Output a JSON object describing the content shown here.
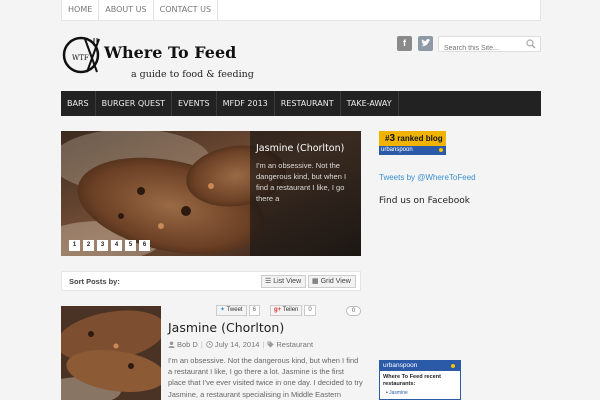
{
  "topnav": {
    "items": [
      "Home",
      "About Us",
      "Contact Us"
    ]
  },
  "logo": {
    "mark_text": "WTF",
    "name": "Where To Feed",
    "tagline": "a guide to food & feeding"
  },
  "header": {
    "search_placeholder": "Search this Site...",
    "social_icons": [
      "facebook-icon",
      "twitter-icon"
    ]
  },
  "mainnav": {
    "items": [
      "Bars",
      "Burger Quest",
      "Events",
      "MFDF 2013",
      "Restaurant",
      "Take-Away"
    ]
  },
  "slider": {
    "title": "Jasmine (Chorlton)",
    "text": "I'm an obsessive. Not the dangerous kind, but when I find a restaurant I like, I go there a",
    "pages": [
      "1",
      "2",
      "3",
      "4",
      "5",
      "6"
    ]
  },
  "sortbar": {
    "label": "Sort Posts by:",
    "list_view": "List View",
    "grid_view": "Grid View"
  },
  "post": {
    "share": {
      "tweet": "Tweet",
      "tweet_count": "6",
      "gplus": "Teilen",
      "gplus_count": "0"
    },
    "comments": "0",
    "title": "Jasmine (Chorlton)",
    "author": "Bob D",
    "date": "July 14, 2014",
    "category": "Restaurant",
    "excerpt": "I'm an obsessive. Not the dangerous kind, but when I find a restaurant I like, I go there a lot. Jasmine is the first place that I've ever visited twice in one day. I decided to try Jasmine, a restaurant specialising in Middle Eastern"
  },
  "sidebar": {
    "badge": {
      "rank": "3",
      "rank_suffix": "ranked blog",
      "brand": "urbanspoon"
    },
    "tweets_link": "Tweets by @WhereToFeed",
    "facebook_heading": "Find us on Facebook",
    "widget": {
      "brand": "urbanspoon",
      "title": "Where To Feed recent restaurants:",
      "items": [
        "Jasmine"
      ]
    }
  },
  "colors": {
    "nav_bg": "#222222",
    "accent_link": "#3a8fd0",
    "urbanspoon_blue": "#2b5aa8",
    "badge_gold": "#f0b400"
  }
}
